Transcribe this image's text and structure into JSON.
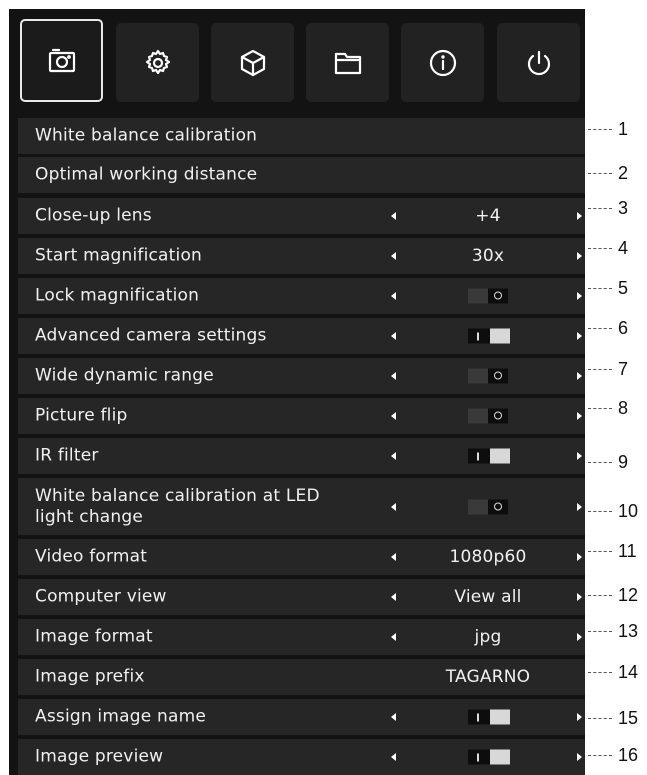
{
  "tabs": [
    {
      "icon": "camera-icon",
      "active": true
    },
    {
      "icon": "gear-icon",
      "active": false
    },
    {
      "icon": "cube-icon",
      "active": false
    },
    {
      "icon": "folder-icon",
      "active": false
    },
    {
      "icon": "info-icon",
      "active": false
    },
    {
      "icon": "power-icon",
      "active": false
    }
  ],
  "rows": [
    {
      "label": "White balance calibration",
      "kind": "action"
    },
    {
      "label": "Optimal working distance",
      "kind": "action"
    },
    {
      "label": "Close-up lens",
      "kind": "select",
      "value": "+4"
    },
    {
      "label": "Start magnification",
      "kind": "select",
      "value": "30x"
    },
    {
      "label": "Lock magnification",
      "kind": "toggle",
      "state": "off"
    },
    {
      "label": "Advanced camera settings",
      "kind": "toggle",
      "state": "on"
    },
    {
      "label": "Wide dynamic range",
      "kind": "toggle",
      "state": "off"
    },
    {
      "label": "Picture flip",
      "kind": "toggle",
      "state": "off"
    },
    {
      "label": "IR filter",
      "kind": "toggle",
      "state": "on"
    },
    {
      "label": "White balance calibration at LED light change",
      "kind": "toggle",
      "state": "off"
    },
    {
      "label": "Video format",
      "kind": "select",
      "value": "1080p60"
    },
    {
      "label": "Computer view",
      "kind": "select",
      "value": "View all"
    },
    {
      "label": "Image format",
      "kind": "select",
      "value": "jpg"
    },
    {
      "label": "Image prefix",
      "kind": "text",
      "value": "TAGARNO"
    },
    {
      "label": "Assign image name",
      "kind": "toggle",
      "state": "on"
    },
    {
      "label": "Image preview",
      "kind": "toggle",
      "state": "on"
    }
  ],
  "callouts": [
    "1",
    "2",
    "3",
    "4",
    "5",
    "6",
    "7",
    "8",
    "9",
    "10",
    "11",
    "12",
    "13",
    "14",
    "15",
    "16"
  ],
  "colors": {
    "panel": "#131313",
    "row": "#262626",
    "text": "#f0f0f0"
  }
}
